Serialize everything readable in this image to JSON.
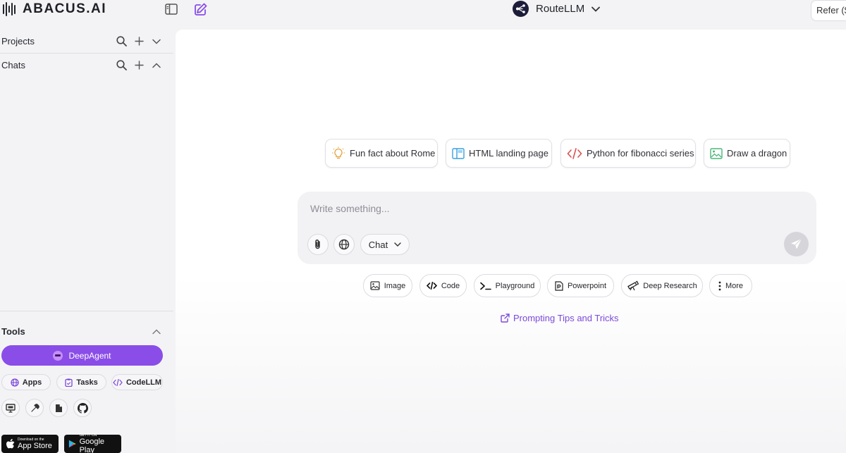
{
  "brand": {
    "name": "ABACUS.AI"
  },
  "header": {
    "model_name": "RouteLLM",
    "refer_label": "Refer ($"
  },
  "sidebar": {
    "projects_label": "Projects",
    "chats_label": "Chats",
    "tools_label": "Tools",
    "deepagent_label": "DeepAgent",
    "tool_pills": [
      "Apps",
      "Tasks",
      "CodeLLM"
    ],
    "app_store": {
      "line1": "Download on the",
      "line2": "App Store"
    },
    "google_play": {
      "line1": "GET IT ON",
      "line2": "Google Play"
    }
  },
  "suggestions": [
    {
      "label": "Fun fact about Rome",
      "icon": "lightbulb-icon"
    },
    {
      "label": "HTML landing page",
      "icon": "layout-icon"
    },
    {
      "label": "Python for fibonacci series",
      "icon": "code-icon"
    },
    {
      "label": "Draw a dragon",
      "icon": "image-icon"
    }
  ],
  "composer": {
    "placeholder": "Write something...",
    "mode_label": "Chat"
  },
  "actions": [
    "Image",
    "Code",
    "Playground",
    "Powerpoint",
    "Deep Research",
    "More"
  ],
  "tips_link": "Prompting Tips and Tricks",
  "colors": {
    "accent": "#8a4de8",
    "link": "#7c4ad9",
    "sidebar_bg": "#f3f3f5",
    "main_bg": "#ffffff"
  }
}
